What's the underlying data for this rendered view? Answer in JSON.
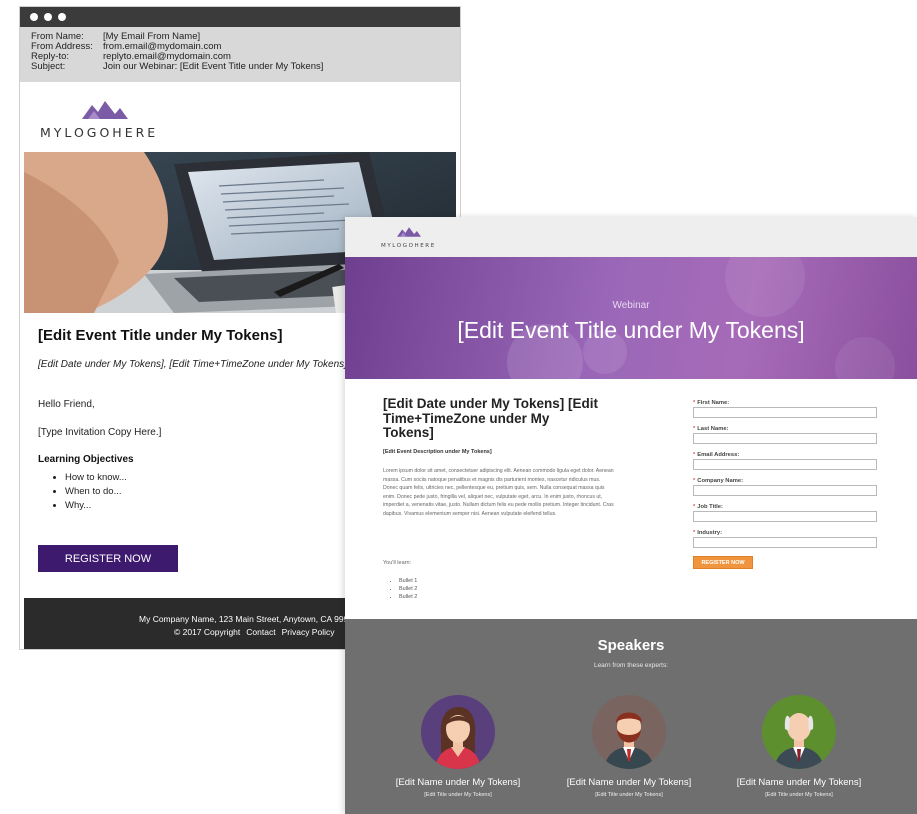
{
  "email": {
    "headers": [
      {
        "key": "From Name:",
        "value": "[My Email From Name]"
      },
      {
        "key": "From Address:",
        "value": "from.email@mydomain.com"
      },
      {
        "key": "Reply-to:",
        "value": "replyto.email@mydomain.com"
      },
      {
        "key": "Subject:",
        "value": "Join our Webinar: [Edit Event Title under My Tokens]"
      }
    ],
    "logo_text": "MYLOGOHERE",
    "event_title": "[Edit Event Title under My Tokens]",
    "event_datetime": "[Edit Date under My Tokens], [Edit Time+TimeZone under My Tokens]",
    "greeting": "Hello Friend,",
    "invitation": "[Type Invitation Copy Here.]",
    "objectives_heading": "Learning Objectives",
    "objectives": [
      "How to know...",
      "When to do...",
      "Why..."
    ],
    "register_label": "REGISTER NOW",
    "footer": {
      "address": "My Company Name, 123 Main Street, Anytown, CA 99999",
      "copyright": "© 2017 Copyright",
      "contact": "Contact",
      "privacy": "Privacy Policy"
    }
  },
  "landing": {
    "logo_text": "MYLOGOHERE",
    "hero_sub": "Webinar",
    "hero_title": "[Edit Event Title under My Tokens]",
    "date_title": "[Edit Date under My Tokens] [Edit Time+TimeZone under My Tokens]",
    "description_heading": "[Edit Event Description under My Tokens]",
    "lorem": "Lorem ipsum dolor sit amet, consectetuer adipiscing elit. Aenean commodo ligula eget dolor. Aenean massa. Cum sociis natoque penatibus et magnis dis parturient montes, nascetur ridiculus mus. Donec quam felis, ultricies nec, pellentesque eu, pretium quis, sem. Nulla consequat massa quis enim. Donec pede justo, fringilla vel, aliquet nec, vulputate eget, arcu. In enim justo, rhoncus ut, imperdiet a, venenatis vitae, justo. Nullam dictum felis eu pede mollis pretium. Integer tincidunt. Cras dapibus. Vivamus elementum semper nisi. Aenean vulputate eleifend tellus.",
    "learn_label": "You'll learn:",
    "bullets": [
      "Bullet 1",
      "Bullet 2",
      "Bullet 2"
    ],
    "form": {
      "fields": [
        {
          "label": "First Name:",
          "value": ""
        },
        {
          "label": "Last Name:",
          "value": ""
        },
        {
          "label": "Email Address:",
          "value": ""
        },
        {
          "label": "Company Name:",
          "value": ""
        },
        {
          "label": "Job Title:",
          "value": ""
        },
        {
          "label": "Industry:",
          "value": ""
        }
      ],
      "required_mark": "*",
      "submit_label": "REGISTER NOW"
    },
    "speakers_heading": "Speakers",
    "speakers_sub": "Learn from these experts:",
    "speakers": [
      {
        "name": "[Edit Name under My Tokens]",
        "title": "[Edit Title under My Tokens]",
        "avatar_bg": "#5a3f7d"
      },
      {
        "name": "[Edit Name under My Tokens]",
        "title": "[Edit Title under My Tokens]",
        "avatar_bg": "#7a6460"
      },
      {
        "name": "[Edit Name under My Tokens]",
        "title": "[Edit Title under My Tokens]",
        "avatar_bg": "#5e8f2e"
      }
    ]
  },
  "colors": {
    "brand_purple": "#3d1a6e",
    "hero_purple": "#9a67b8",
    "cta_orange": "#f0943d",
    "speakers_bg": "#6f6f6f"
  }
}
